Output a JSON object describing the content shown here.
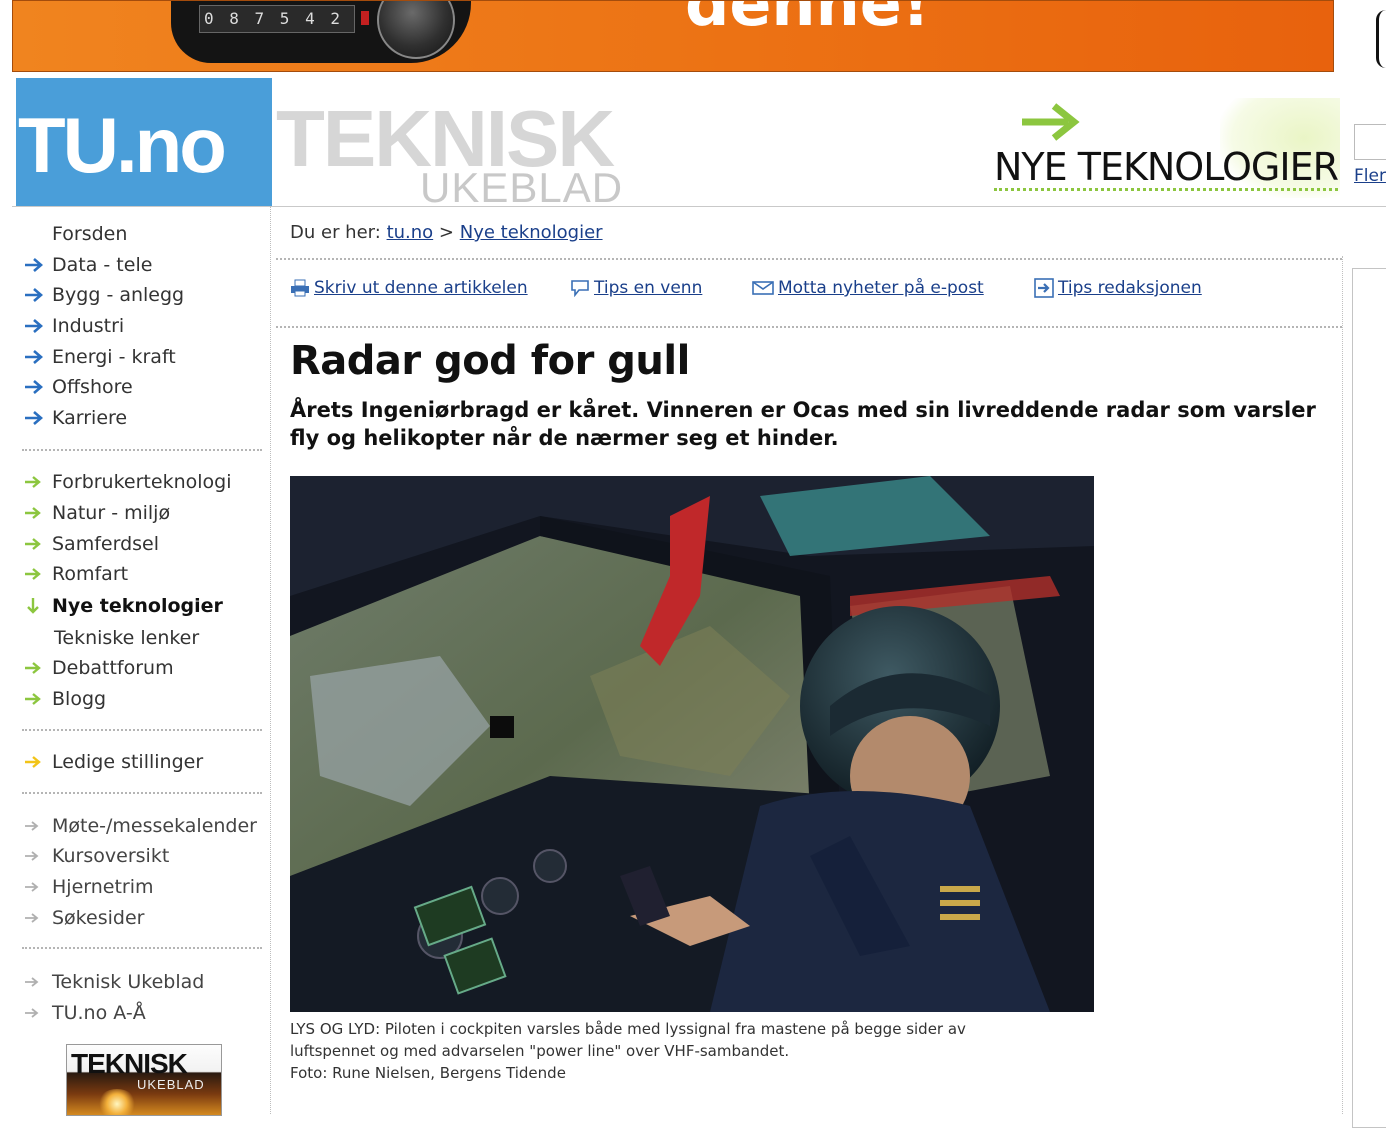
{
  "banner": {
    "display_digits": "0 8 7 5 4 2",
    "slogan": "denne!"
  },
  "header": {
    "logo": "TU.no",
    "masthead_line1": "TEKNISK",
    "masthead_line2": "UKEBLAD",
    "section_title": "NYE TEKNOLOGIER",
    "flere_link": "Fler",
    "accent_color": "#8cc63f",
    "logo_color": "#4a9ed9"
  },
  "sidebar": {
    "group1": [
      {
        "label": "Forsden",
        "icon": "none"
      },
      {
        "label": "Data - tele",
        "icon": "blue-arrow-icon"
      },
      {
        "label": "Bygg - anlegg",
        "icon": "blue-arrow-icon"
      },
      {
        "label": "Industri",
        "icon": "blue-arrow-icon"
      },
      {
        "label": "Energi - kraft",
        "icon": "blue-arrow-icon"
      },
      {
        "label": "Offshore",
        "icon": "blue-arrow-icon"
      },
      {
        "label": "Karriere",
        "icon": "blue-arrow-icon"
      }
    ],
    "group2": [
      {
        "label": "Forbrukerteknologi",
        "icon": "green-arrow-icon"
      },
      {
        "label": "Natur - miljø",
        "icon": "green-arrow-icon"
      },
      {
        "label": "Samferdsel",
        "icon": "green-arrow-icon"
      },
      {
        "label": "Romfart",
        "icon": "green-arrow-icon"
      },
      {
        "label": "Nye teknologier",
        "icon": "green-down-arrow-icon",
        "active": true
      },
      {
        "label": "Tekniske lenker",
        "icon": "none"
      },
      {
        "label": "Debattforum",
        "icon": "green-arrow-icon"
      },
      {
        "label": "Blogg",
        "icon": "green-arrow-icon"
      }
    ],
    "group3": [
      {
        "label": "Ledige stillinger",
        "icon": "yellow-arrow-icon"
      }
    ],
    "group4": [
      {
        "label": "Møte-/messekalender",
        "icon": "gray-arrow-icon"
      },
      {
        "label": "Kursoversikt",
        "icon": "gray-arrow-icon"
      },
      {
        "label": "Hjernetrim",
        "icon": "gray-arrow-icon"
      },
      {
        "label": "Søkesider",
        "icon": "gray-arrow-icon"
      }
    ],
    "group5": [
      {
        "label": "Teknisk Ukeblad",
        "icon": "gray-arrow-icon"
      },
      {
        "label": "TU.no A-Å",
        "icon": "gray-arrow-icon"
      }
    ],
    "magazine_title": "TEKNISK",
    "magazine_sub": "UKEBLAD"
  },
  "breadcrumb": {
    "prefix": "Du er her:",
    "home": "tu.no",
    "separator": ">",
    "current": "Nye teknologier"
  },
  "tools": [
    {
      "label": "Skriv ut denne artikkelen",
      "icon": "printer-icon"
    },
    {
      "label": "Tips en venn",
      "icon": "speech-bubble-icon"
    },
    {
      "label": "Motta nyheter på e-post",
      "icon": "envelope-icon"
    },
    {
      "label": "Tips redaksjonen",
      "icon": "arrow-box-icon"
    }
  ],
  "article": {
    "headline": "Radar god for gull",
    "lead": "Årets Ingeniørbragd er kåret. Vinneren er Ocas med sin livreddende radar som varsler fly og helikopter når de nærmer seg et hinder.",
    "caption_line1": "LYS OG LYD: Piloten i cockpiten varsles både med lyssignal fra mastene på begge sider av",
    "caption_line2": "luftspennet og med advarselen \"power line\" over VHF-sambandet.",
    "caption_line3": "Foto: Rune Nielsen, Bergens Tidende"
  }
}
